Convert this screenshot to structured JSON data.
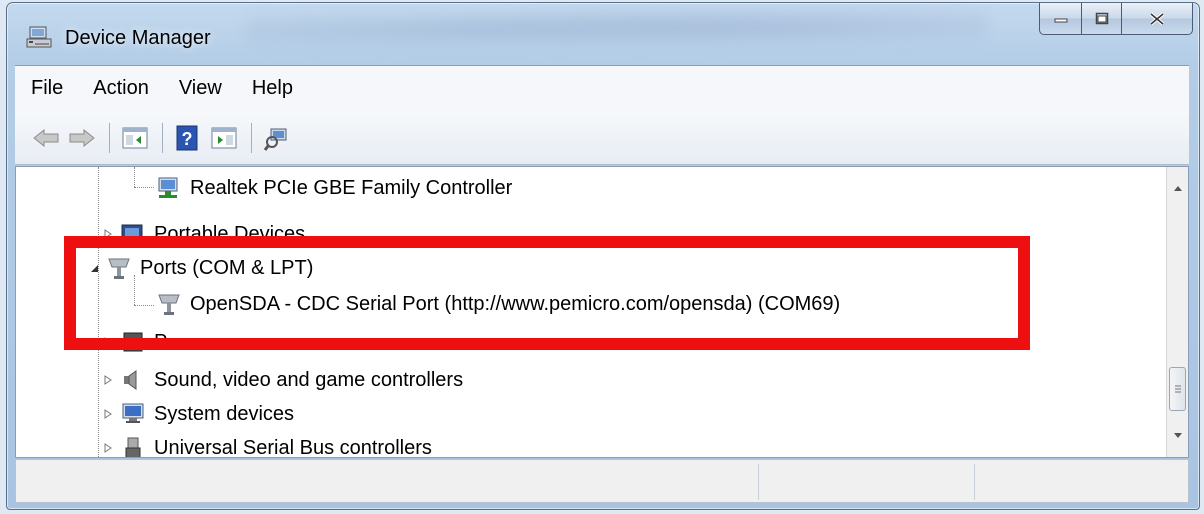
{
  "window": {
    "title": "Device Manager",
    "minimize_icon": "minimize-icon",
    "maximize_icon": "maximize-icon",
    "close_icon": "close-icon"
  },
  "menu": [
    "File",
    "Action",
    "View",
    "Help"
  ],
  "toolbar": [
    "back-arrow-icon",
    "forward-arrow-icon",
    "show-hide-tree-icon",
    "help-icon",
    "show-hide-action-pane-icon",
    "scan-hardware-icon"
  ],
  "tree": {
    "items": [
      {
        "label": "Realtek PCIe GBE Family Controller",
        "icon": "network-adapter-icon",
        "expander": "none"
      },
      {
        "label": "Portable Devices",
        "icon": "portable-device-icon",
        "expander": "collapsed"
      },
      {
        "label": "Ports (COM & LPT)",
        "icon": "port-icon",
        "expander": "expanded"
      },
      {
        "label": "OpenSDA - CDC Serial Port (http://www.pemicro.com/opensda) (COM69)",
        "icon": "serial-port-icon",
        "expander": "none"
      },
      {
        "label": "P",
        "icon": "processor-icon",
        "expander": "collapsed"
      },
      {
        "label": "Sound, video and game controllers",
        "icon": "speaker-icon",
        "expander": "collapsed"
      },
      {
        "label": "System devices",
        "icon": "computer-icon",
        "expander": "collapsed"
      },
      {
        "label": "Universal Serial Bus controllers",
        "icon": "usb-icon",
        "expander": "collapsed"
      }
    ]
  },
  "highlight_color": "#ee1010"
}
